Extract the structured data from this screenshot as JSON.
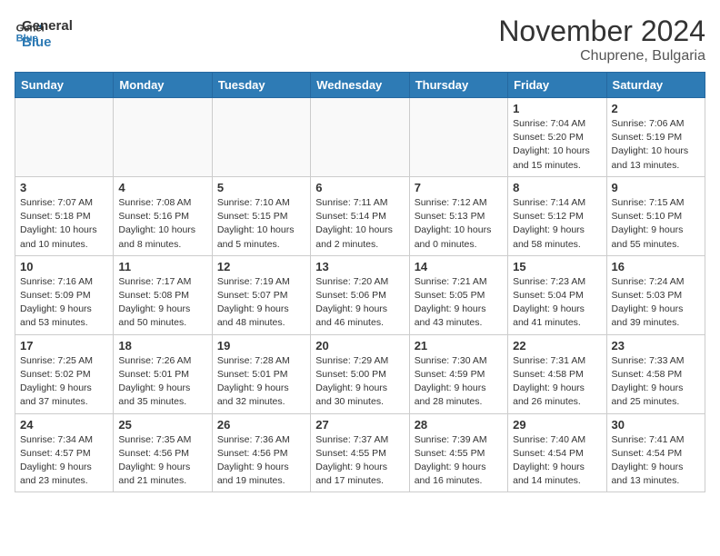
{
  "header": {
    "logo_line1": "General",
    "logo_line2": "Blue",
    "month_title": "November 2024",
    "location": "Chuprene, Bulgaria"
  },
  "weekdays": [
    "Sunday",
    "Monday",
    "Tuesday",
    "Wednesday",
    "Thursday",
    "Friday",
    "Saturday"
  ],
  "weeks": [
    [
      {
        "day": "",
        "info": ""
      },
      {
        "day": "",
        "info": ""
      },
      {
        "day": "",
        "info": ""
      },
      {
        "day": "",
        "info": ""
      },
      {
        "day": "",
        "info": ""
      },
      {
        "day": "1",
        "info": "Sunrise: 7:04 AM\nSunset: 5:20 PM\nDaylight: 10 hours\nand 15 minutes."
      },
      {
        "day": "2",
        "info": "Sunrise: 7:06 AM\nSunset: 5:19 PM\nDaylight: 10 hours\nand 13 minutes."
      }
    ],
    [
      {
        "day": "3",
        "info": "Sunrise: 7:07 AM\nSunset: 5:18 PM\nDaylight: 10 hours\nand 10 minutes."
      },
      {
        "day": "4",
        "info": "Sunrise: 7:08 AM\nSunset: 5:16 PM\nDaylight: 10 hours\nand 8 minutes."
      },
      {
        "day": "5",
        "info": "Sunrise: 7:10 AM\nSunset: 5:15 PM\nDaylight: 10 hours\nand 5 minutes."
      },
      {
        "day": "6",
        "info": "Sunrise: 7:11 AM\nSunset: 5:14 PM\nDaylight: 10 hours\nand 2 minutes."
      },
      {
        "day": "7",
        "info": "Sunrise: 7:12 AM\nSunset: 5:13 PM\nDaylight: 10 hours\nand 0 minutes."
      },
      {
        "day": "8",
        "info": "Sunrise: 7:14 AM\nSunset: 5:12 PM\nDaylight: 9 hours\nand 58 minutes."
      },
      {
        "day": "9",
        "info": "Sunrise: 7:15 AM\nSunset: 5:10 PM\nDaylight: 9 hours\nand 55 minutes."
      }
    ],
    [
      {
        "day": "10",
        "info": "Sunrise: 7:16 AM\nSunset: 5:09 PM\nDaylight: 9 hours\nand 53 minutes."
      },
      {
        "day": "11",
        "info": "Sunrise: 7:17 AM\nSunset: 5:08 PM\nDaylight: 9 hours\nand 50 minutes."
      },
      {
        "day": "12",
        "info": "Sunrise: 7:19 AM\nSunset: 5:07 PM\nDaylight: 9 hours\nand 48 minutes."
      },
      {
        "day": "13",
        "info": "Sunrise: 7:20 AM\nSunset: 5:06 PM\nDaylight: 9 hours\nand 46 minutes."
      },
      {
        "day": "14",
        "info": "Sunrise: 7:21 AM\nSunset: 5:05 PM\nDaylight: 9 hours\nand 43 minutes."
      },
      {
        "day": "15",
        "info": "Sunrise: 7:23 AM\nSunset: 5:04 PM\nDaylight: 9 hours\nand 41 minutes."
      },
      {
        "day": "16",
        "info": "Sunrise: 7:24 AM\nSunset: 5:03 PM\nDaylight: 9 hours\nand 39 minutes."
      }
    ],
    [
      {
        "day": "17",
        "info": "Sunrise: 7:25 AM\nSunset: 5:02 PM\nDaylight: 9 hours\nand 37 minutes."
      },
      {
        "day": "18",
        "info": "Sunrise: 7:26 AM\nSunset: 5:01 PM\nDaylight: 9 hours\nand 35 minutes."
      },
      {
        "day": "19",
        "info": "Sunrise: 7:28 AM\nSunset: 5:01 PM\nDaylight: 9 hours\nand 32 minutes."
      },
      {
        "day": "20",
        "info": "Sunrise: 7:29 AM\nSunset: 5:00 PM\nDaylight: 9 hours\nand 30 minutes."
      },
      {
        "day": "21",
        "info": "Sunrise: 7:30 AM\nSunset: 4:59 PM\nDaylight: 9 hours\nand 28 minutes."
      },
      {
        "day": "22",
        "info": "Sunrise: 7:31 AM\nSunset: 4:58 PM\nDaylight: 9 hours\nand 26 minutes."
      },
      {
        "day": "23",
        "info": "Sunrise: 7:33 AM\nSunset: 4:58 PM\nDaylight: 9 hours\nand 25 minutes."
      }
    ],
    [
      {
        "day": "24",
        "info": "Sunrise: 7:34 AM\nSunset: 4:57 PM\nDaylight: 9 hours\nand 23 minutes."
      },
      {
        "day": "25",
        "info": "Sunrise: 7:35 AM\nSunset: 4:56 PM\nDaylight: 9 hours\nand 21 minutes."
      },
      {
        "day": "26",
        "info": "Sunrise: 7:36 AM\nSunset: 4:56 PM\nDaylight: 9 hours\nand 19 minutes."
      },
      {
        "day": "27",
        "info": "Sunrise: 7:37 AM\nSunset: 4:55 PM\nDaylight: 9 hours\nand 17 minutes."
      },
      {
        "day": "28",
        "info": "Sunrise: 7:39 AM\nSunset: 4:55 PM\nDaylight: 9 hours\nand 16 minutes."
      },
      {
        "day": "29",
        "info": "Sunrise: 7:40 AM\nSunset: 4:54 PM\nDaylight: 9 hours\nand 14 minutes."
      },
      {
        "day": "30",
        "info": "Sunrise: 7:41 AM\nSunset: 4:54 PM\nDaylight: 9 hours\nand 13 minutes."
      }
    ]
  ]
}
